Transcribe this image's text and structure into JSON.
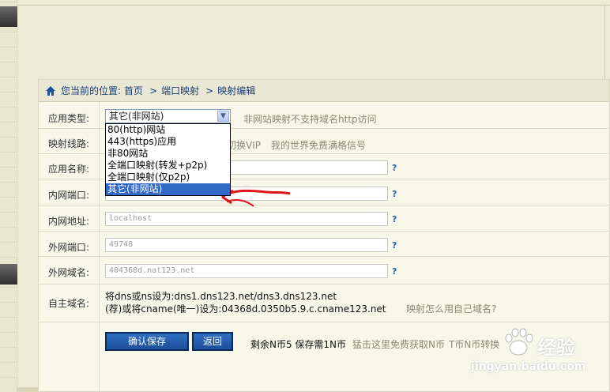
{
  "breadcrumb": {
    "prefix": "您当前的位置:",
    "items": [
      "首页",
      "端口映射",
      "映射编辑"
    ],
    "separator": ">"
  },
  "form": {
    "app_type": {
      "label": "应用类型:",
      "selected": "其它(非网站)",
      "options": [
        "80(http)网站",
        "443(https)应用",
        "非80网站",
        "全端口映射(转发+p2p)",
        "全端口映射(仅p2p)",
        "其它(非网站)"
      ],
      "hint": "非网站映射不支持域名http访问"
    },
    "route": {
      "label": "映射线路:",
      "links": [
        "切换VIP",
        "我的世界免费满格信号"
      ]
    },
    "app_name": {
      "label": "应用名称:",
      "value": ""
    },
    "internal_port": {
      "label": "内网端口:",
      "value": ""
    },
    "internal_addr": {
      "label": "内网地址:",
      "value": "localhost"
    },
    "external_port": {
      "label": "外网端口:",
      "value": "49748"
    },
    "external_domain": {
      "label": "外网域名:",
      "value": "404368d.nat123.net"
    },
    "custom_domain": {
      "label": "自主域名:",
      "line1": "将dns或ns设为:dns1.dns123.net/dns3.dns123.net",
      "line2": "(荐)或将cname(唯一)设为:04368d.0350b5.9.c.cname123.net",
      "help_link": "映射怎么用自己域名?"
    },
    "help_mark": "?"
  },
  "actions": {
    "save": "确认保存",
    "back": "返回",
    "balance_text": "剩余N币5 保存需1N币",
    "free_link": "猛击这里免费获取N币",
    "exchange_link": "T币N币转换"
  },
  "watermark": {
    "brand": "经验",
    "url": "jingyan.baidu.com"
  },
  "colors": {
    "link": "#1b3d7a",
    "hint": "#8a8a74",
    "button": "#2462b0",
    "selected_option": "#316ac5",
    "annotation": "#e0141b"
  },
  "icons": [
    "home-icon",
    "chevron-down-icon",
    "red-arrow-annotation",
    "baidu-paw-logo"
  ]
}
